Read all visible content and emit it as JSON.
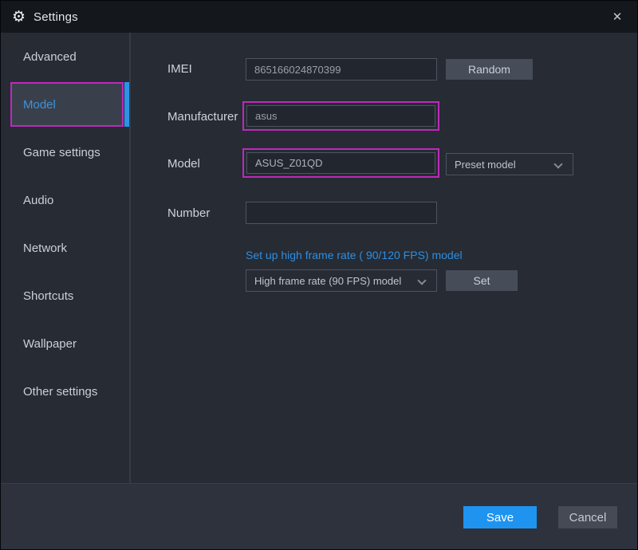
{
  "window": {
    "title": "Settings",
    "gear_icon": "⚙",
    "close_icon": "✕"
  },
  "sidebar": {
    "items": [
      {
        "label": "Advanced",
        "selected": false
      },
      {
        "label": "Model",
        "selected": true
      },
      {
        "label": "Game settings",
        "selected": false
      },
      {
        "label": "Audio",
        "selected": false
      },
      {
        "label": "Network",
        "selected": false
      },
      {
        "label": "Shortcuts",
        "selected": false
      },
      {
        "label": "Wallpaper",
        "selected": false
      },
      {
        "label": "Other settings",
        "selected": false
      }
    ]
  },
  "form": {
    "imei": {
      "label": "IMEI",
      "value": "865166024870399",
      "random_label": "Random"
    },
    "manufacturer": {
      "label": "Manufacturer",
      "value": "asus"
    },
    "model": {
      "label": "Model",
      "value": "ASUS_Z01QD",
      "preset_dropdown": "Preset model"
    },
    "number": {
      "label": "Number",
      "value": ""
    },
    "high_frame_rate": {
      "link": "Set up high frame rate ( 90/120 FPS) model",
      "dropdown": "High frame rate (90 FPS) model",
      "set_label": "Set"
    }
  },
  "footer": {
    "save_label": "Save",
    "cancel_label": "Cancel"
  },
  "colors": {
    "highlight_magenta": "#bc2abc",
    "accent_blue": "#2e93e8",
    "selected_text_blue": "#3d93da",
    "link_blue": "#2e8ee2",
    "save_blue": "#1e94f0",
    "titlebar_bg": "#14171c",
    "content_bg": "#262b34",
    "footer_bg": "#2e323d"
  }
}
